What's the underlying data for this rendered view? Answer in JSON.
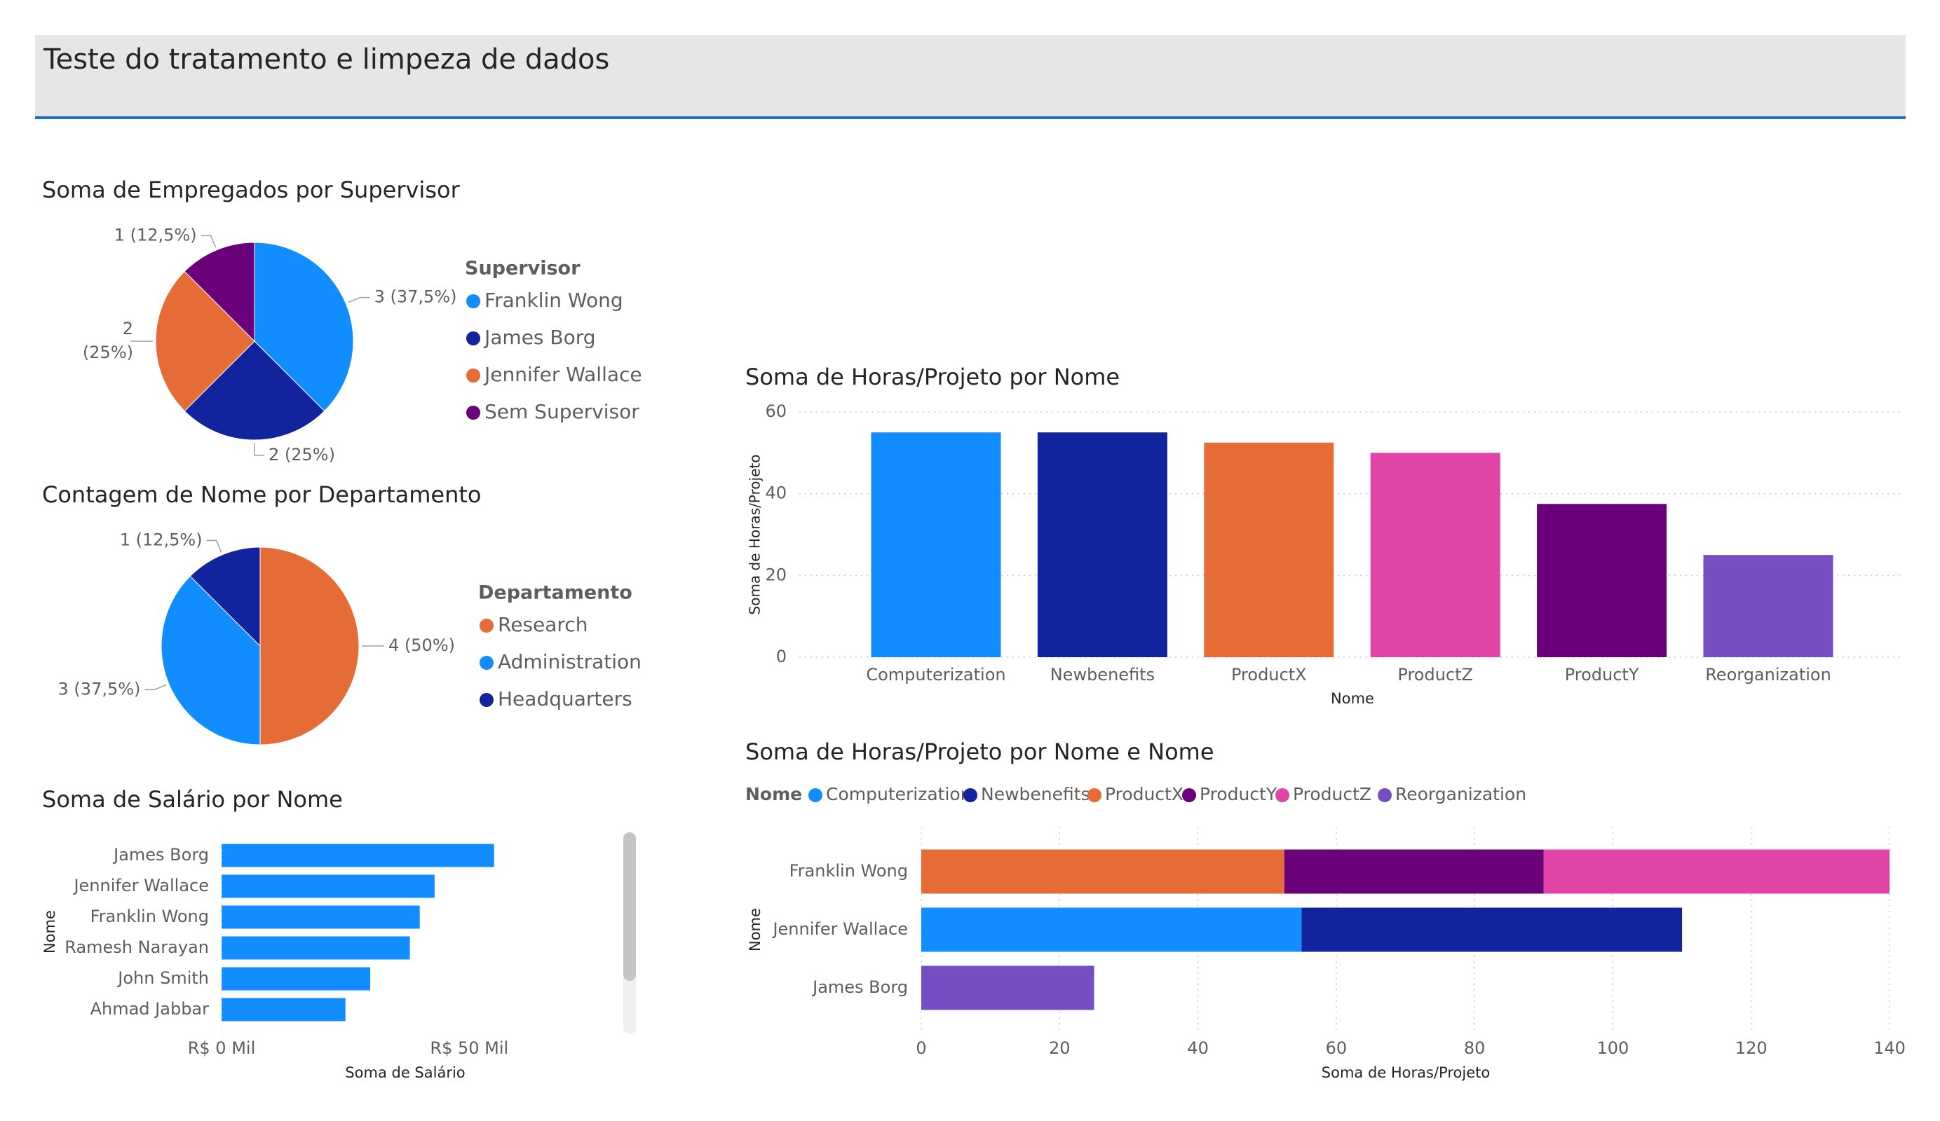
{
  "header": {
    "title": "Teste do tratamento e limpeza de dados"
  },
  "colors": {
    "blue": "#118dff",
    "navy": "#12239e",
    "orange": "#e66c37",
    "purple": "#6b007b",
    "pink": "#e044a7",
    "violet": "#744ec2",
    "accent_line": "#1f6fc5"
  },
  "icons": {
    "legend_marker": "circle-icon"
  },
  "chart_data": [
    {
      "type": "pie",
      "title": "Soma de Empregados por Supervisor",
      "legend_title": "Supervisor",
      "legend_position": "right",
      "categories": [
        "Franklin Wong",
        "James Borg",
        "Jennifer Wallace",
        "Sem Supervisor"
      ],
      "values": [
        3,
        2,
        2,
        1
      ],
      "labels": [
        "3 (37,5%)",
        "2 (25%)",
        "2 (25%)",
        "1 (12,5%)"
      ],
      "colors": [
        "#118dff",
        "#12239e",
        "#e66c37",
        "#6b007b"
      ]
    },
    {
      "type": "pie",
      "title": "Contagem de Nome por Departamento",
      "legend_title": "Departamento",
      "legend_position": "right",
      "categories": [
        "Research",
        "Administration",
        "Headquarters"
      ],
      "values": [
        4,
        3,
        1
      ],
      "labels": [
        "4 (50%)",
        "3 (37,5%)",
        "1 (12,5%)"
      ],
      "colors": [
        "#e66c37",
        "#118dff",
        "#12239e"
      ]
    },
    {
      "type": "bar",
      "orientation": "horizontal",
      "title": "Soma de Salário por Nome",
      "xlabel": "Soma de Salário",
      "ylabel": "Nome",
      "categories": [
        "James Borg",
        "Jennifer Wallace",
        "Franklin Wong",
        "Ramesh Narayan",
        "John Smith",
        "Ahmad Jabbar"
      ],
      "values": [
        55000,
        43000,
        40000,
        38000,
        30000,
        25000
      ],
      "xlim": [
        0,
        60000
      ],
      "xticks": [
        0,
        50000
      ],
      "xtick_labels": [
        "R$ 0 Mil",
        "R$ 50 Mil"
      ],
      "color": "#118dff",
      "grid": false
    },
    {
      "type": "bar",
      "orientation": "vertical",
      "title": "Soma de Horas/Projeto por Nome",
      "xlabel": "Nome",
      "ylabel": "Soma de Horas/Projeto",
      "categories": [
        "Computerization",
        "Newbenefits",
        "ProductX",
        "ProductZ",
        "ProductY",
        "Reorganization"
      ],
      "values": [
        55,
        55,
        52.5,
        50,
        37.5,
        25
      ],
      "colors": [
        "#118dff",
        "#12239e",
        "#e66c37",
        "#e044a7",
        "#6b007b",
        "#744ec2"
      ],
      "ylim": [
        0,
        60
      ],
      "yticks": [
        0,
        20,
        40,
        60
      ],
      "grid": true
    },
    {
      "type": "bar",
      "orientation": "horizontal",
      "stacked": true,
      "title": "Soma de Horas/Projeto por Nome e Nome",
      "xlabel": "Soma de Horas/Projeto",
      "ylabel": "Nome",
      "legend_title": "Nome",
      "legend_position": "top-left",
      "categories": [
        "Franklin Wong",
        "Jennifer Wallace",
        "James Borg"
      ],
      "xlim": [
        0,
        140
      ],
      "xticks": [
        0,
        20,
        40,
        60,
        80,
        100,
        120,
        140
      ],
      "grid": true,
      "series": [
        {
          "name": "Computerization",
          "color": "#118dff",
          "values": [
            0,
            55,
            0
          ]
        },
        {
          "name": "Newbenefits",
          "color": "#12239e",
          "values": [
            0,
            55,
            0
          ]
        },
        {
          "name": "ProductX",
          "color": "#e66c37",
          "values": [
            52.5,
            0,
            0
          ]
        },
        {
          "name": "ProductY",
          "color": "#6b007b",
          "values": [
            37.5,
            0,
            0
          ]
        },
        {
          "name": "ProductZ",
          "color": "#e044a7",
          "values": [
            50,
            0,
            0
          ]
        },
        {
          "name": "Reorganization",
          "color": "#744ec2",
          "values": [
            0,
            0,
            25
          ]
        }
      ]
    }
  ]
}
